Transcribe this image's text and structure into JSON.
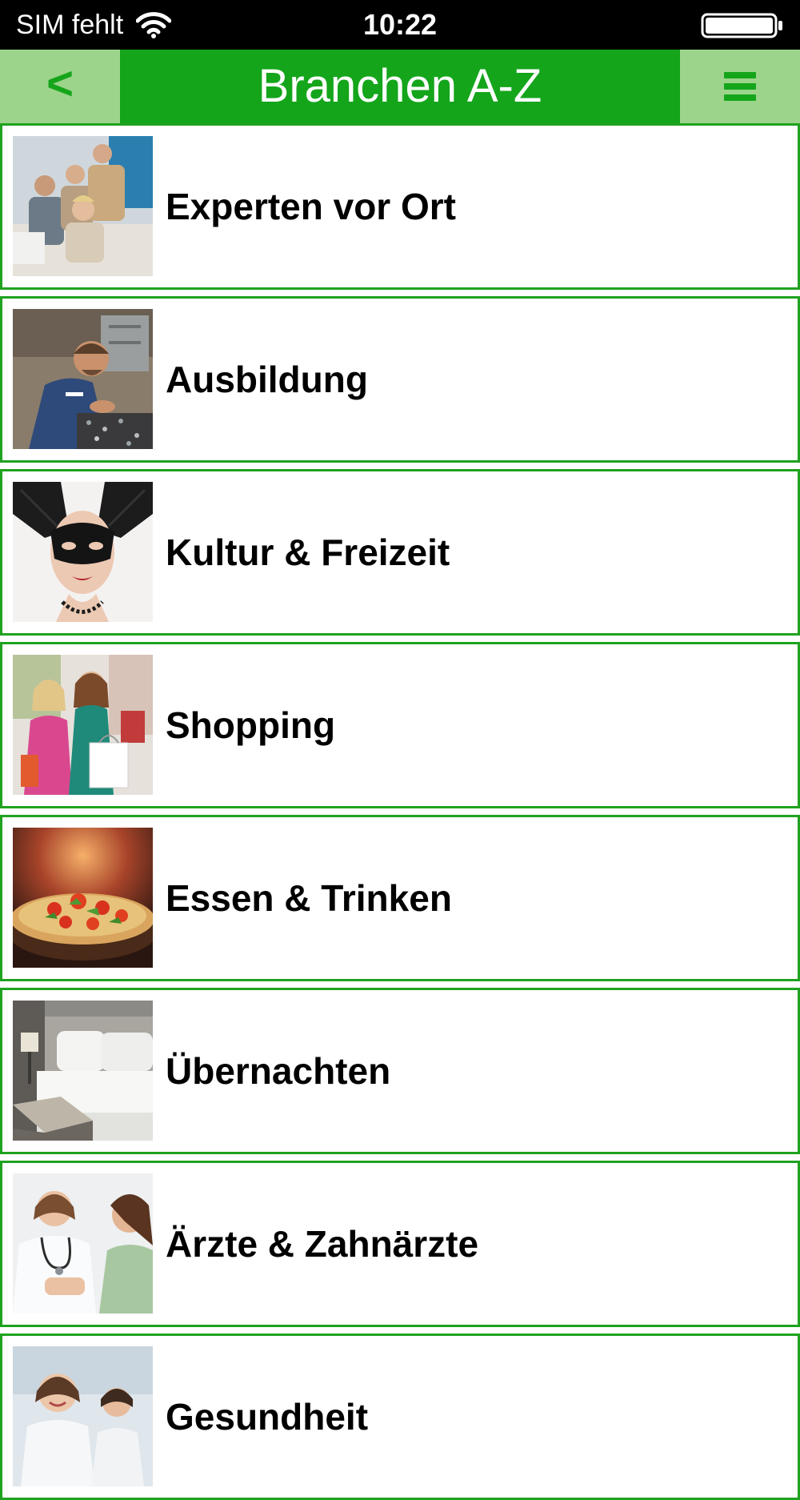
{
  "status_bar": {
    "carrier": "SIM fehlt",
    "time": "10:22"
  },
  "nav": {
    "back_label": "<",
    "title": "Branchen A-Z",
    "menu_icon": "hamburger-menu-icon"
  },
  "colors": {
    "brand_green": "#14a51b",
    "nav_button_bg": "#9cd48b",
    "item_border": "#1fa21f"
  },
  "categories": [
    {
      "label": "Experten vor Ort",
      "image": "business-meeting-photo"
    },
    {
      "label": "Ausbildung",
      "image": "apprentice-workshop-photo"
    },
    {
      "label": "Kultur & Freizeit",
      "image": "masquerade-mask-photo"
    },
    {
      "label": "Shopping",
      "image": "shopping-women-photo"
    },
    {
      "label": "Essen & Trinken",
      "image": "pizza-photo"
    },
    {
      "label": "Übernachten",
      "image": "hotel-bed-photo"
    },
    {
      "label": "Ärzte & Zahnärzte",
      "image": "doctor-patient-photo"
    },
    {
      "label": "Gesundheit",
      "image": "health-people-photo"
    }
  ]
}
